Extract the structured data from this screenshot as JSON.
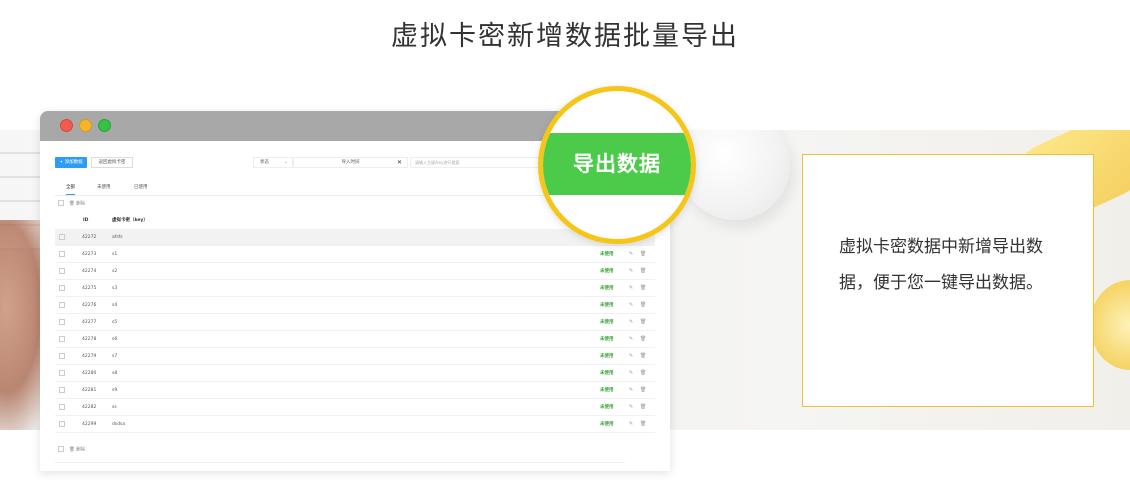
{
  "page_title": "虚拟卡密新增数据批量导出",
  "browser": {
    "window_buttons": [
      "close",
      "minimize",
      "maximize"
    ]
  },
  "app": {
    "toolbar": {
      "add_button": "+ 添加数据",
      "back_button": "返回虚拟卡密",
      "status_select": "状态",
      "time_filter": "导入时间",
      "clear_icon": "✕",
      "search_placeholder": "请输入主键/key进行搜索"
    },
    "tabs": [
      "全部",
      "未使用",
      "已使用"
    ],
    "bulk_delete_label": "删除",
    "table": {
      "columns": {
        "id": "ID",
        "card": "虚拟卡密（key）"
      },
      "rows": [
        {
          "id": "42272",
          "card": "afsfs",
          "state": ""
        },
        {
          "id": "42273",
          "card": "s1",
          "state": "未使用"
        },
        {
          "id": "42274",
          "card": "s2",
          "state": "未使用"
        },
        {
          "id": "42275",
          "card": "s3",
          "state": "未使用"
        },
        {
          "id": "42276",
          "card": "s4",
          "state": "未使用"
        },
        {
          "id": "42277",
          "card": "s5",
          "state": "未使用"
        },
        {
          "id": "42278",
          "card": "s6",
          "state": "未使用"
        },
        {
          "id": "42279",
          "card": "s7",
          "state": "未使用"
        },
        {
          "id": "42280",
          "card": "s8",
          "state": "未使用"
        },
        {
          "id": "42281",
          "card": "s9",
          "state": "未使用"
        },
        {
          "id": "42282",
          "card": "ss",
          "state": "未使用"
        },
        {
          "id": "42299",
          "card": "dsdsa",
          "state": "未使用"
        }
      ]
    }
  },
  "callout_label": "导出数据",
  "description": "虚拟卡密数据中新增导出数据，便于您一键导出数据。",
  "colors": {
    "accent_green": "#4ccb4a",
    "ring_yellow": "#f5c518",
    "primary_blue": "#2d9cf5"
  }
}
